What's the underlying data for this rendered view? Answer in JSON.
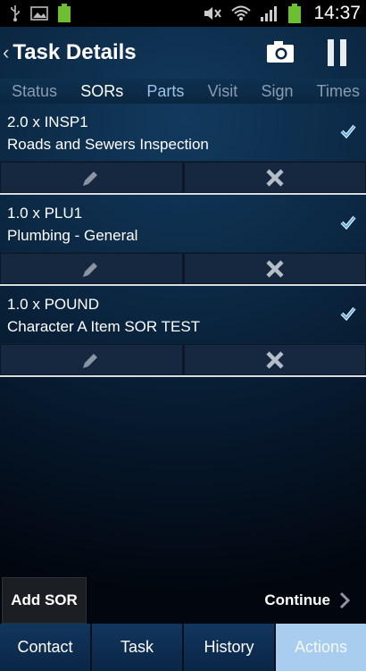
{
  "status_bar": {
    "time": "14:37",
    "left_icons": [
      "usb-icon",
      "image-icon",
      "battery-app-icon"
    ],
    "right_icons": [
      "mute-icon",
      "wifi-icon",
      "signal-icon",
      "battery-icon"
    ]
  },
  "header": {
    "back_glyph": "‹",
    "title": "Task Details",
    "actions": [
      "camera-icon",
      "pause-icon"
    ]
  },
  "tabs": [
    {
      "label": "Status",
      "state": "inactive"
    },
    {
      "label": "SORs",
      "state": "active"
    },
    {
      "label": "Parts",
      "state": "accent"
    },
    {
      "label": "Visit",
      "state": "inactive"
    },
    {
      "label": "Sign",
      "state": "inactive"
    },
    {
      "label": "Times",
      "state": "inactive"
    }
  ],
  "sors": [
    {
      "line1": "2.0 x INSP1",
      "line2": "Roads and Sewers Inspection",
      "checked": true
    },
    {
      "line1": "1.0 x PLU1",
      "line2": "Plumbing - General",
      "checked": true
    },
    {
      "line1": "1.0 x POUND",
      "line2": "Character A Item SOR TEST",
      "checked": true
    }
  ],
  "footer": {
    "add_sor_label": "Add SOR",
    "continue_label": "Continue"
  },
  "nav": [
    {
      "label": "Contact",
      "active": false
    },
    {
      "label": "Task",
      "active": false
    },
    {
      "label": "History",
      "active": false
    },
    {
      "label": "Actions",
      "active": true
    }
  ],
  "colors": {
    "accent_tab": "#9fc1e6",
    "check": "#5aa8f0",
    "active_nav": "#a8cdef",
    "row_action_bg": "#152840"
  }
}
